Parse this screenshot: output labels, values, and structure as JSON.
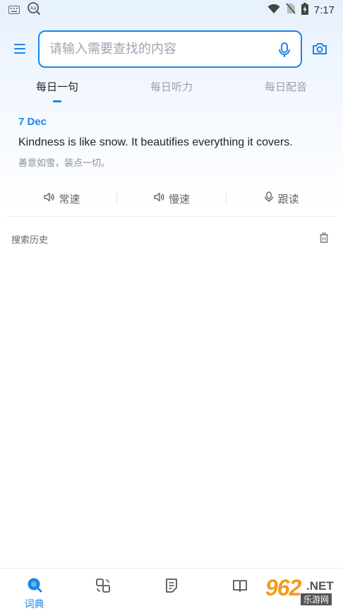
{
  "status_bar": {
    "time": "7:17",
    "left_icons": [
      "keyboard-icon",
      "dictionary-lookup-icon"
    ],
    "right_icons": [
      "wifi-icon",
      "no-sim-icon",
      "battery-charging-icon"
    ]
  },
  "header": {
    "search_placeholder": "请输入需要查找的内容",
    "icons": [
      "menu-icon",
      "microphone-icon",
      "camera-icon"
    ]
  },
  "tabs": [
    {
      "label": "每日一句",
      "active": true
    },
    {
      "label": "每日听力",
      "active": false
    },
    {
      "label": "每日配音",
      "active": false
    }
  ],
  "daily": {
    "date": "7 Dec",
    "sentence_en": "Kindness is like snow. It beautifies everything it covers.",
    "sentence_cn": "善意如雪，装点一切。"
  },
  "actions": [
    {
      "label": "常速",
      "icon": "speaker-icon"
    },
    {
      "label": "慢速",
      "icon": "speaker-icon"
    },
    {
      "label": "跟读",
      "icon": "microphone-icon"
    }
  ],
  "history": {
    "title": "搜索历史",
    "clear_icon": "trash-icon"
  },
  "bottom_nav": [
    {
      "label": "词典",
      "icon": "search-icon",
      "active": true
    },
    {
      "label": "",
      "icon": "translate-icon",
      "active": false
    },
    {
      "label": "",
      "icon": "notes-icon",
      "active": false
    },
    {
      "label": "",
      "icon": "book-icon",
      "active": false
    }
  ],
  "watermark": {
    "big": "962",
    "net": ".NET",
    "cn": "乐游网"
  },
  "colors": {
    "accent": "#1a86e4",
    "text_primary": "#222222",
    "text_secondary": "#8a8f96",
    "tab_inactive": "#9aa0a6",
    "watermark_orange": "#f29b1d"
  }
}
